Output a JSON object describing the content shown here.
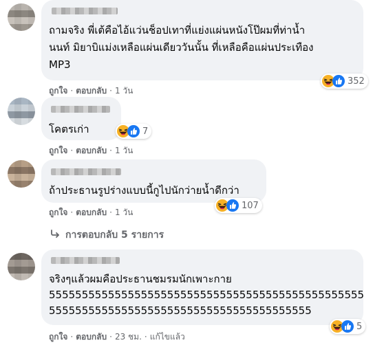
{
  "comments": [
    {
      "lines": [
        "ถามจริง พี่เต้คือไอ้แว่นช็อปเทาที่แย่งแผ่นหนังโป๊ผมที่ท่าน้ำ",
        "นนท์ มิยาบิแม่งเหลือแผ่นเดียววันนั้น ที่เหลือคือแผ่นประเทือง",
        "MP3"
      ],
      "reaction_count": "352",
      "like": "ถูกใจ",
      "reply": "ตอบกลับ",
      "time": "1 วัน"
    },
    {
      "lines": [
        "โคตรเก่า"
      ],
      "reaction_count": "7",
      "like": "ถูกใจ",
      "reply": "ตอบกลับ",
      "time": "1 วัน"
    },
    {
      "lines": [
        "ถ้าประธานรูปร่างแบบนี้กูไปนักว่ายน้ำดีกว่า"
      ],
      "reaction_count": "107",
      "like": "ถูกใจ",
      "reply": "ตอบกลับ",
      "time": "1 วัน",
      "replies_label": "การตอบกลับ 5 รายการ"
    },
    {
      "lines": [
        "จริงๆแล้วผมคือประธานชมรมนักเพาะกาย",
        "555555555555555555555555555555555555555555555555",
        "5555555555555555555555555555555555555555"
      ],
      "reaction_count": "5",
      "like": "ถูกใจ",
      "reply": "ตอบกลับ",
      "time": "23 ชม.",
      "edited": "แก้ไขแล้ว"
    }
  ],
  "colors": {
    "bubble": "#f0f2f5",
    "meta_text": "#65676b",
    "like_blue": "#1877f2",
    "haha_yellow": "#f7b125"
  },
  "icons": [
    "haha-reaction-icon",
    "like-reaction-icon",
    "reply-arrow-icon"
  ]
}
